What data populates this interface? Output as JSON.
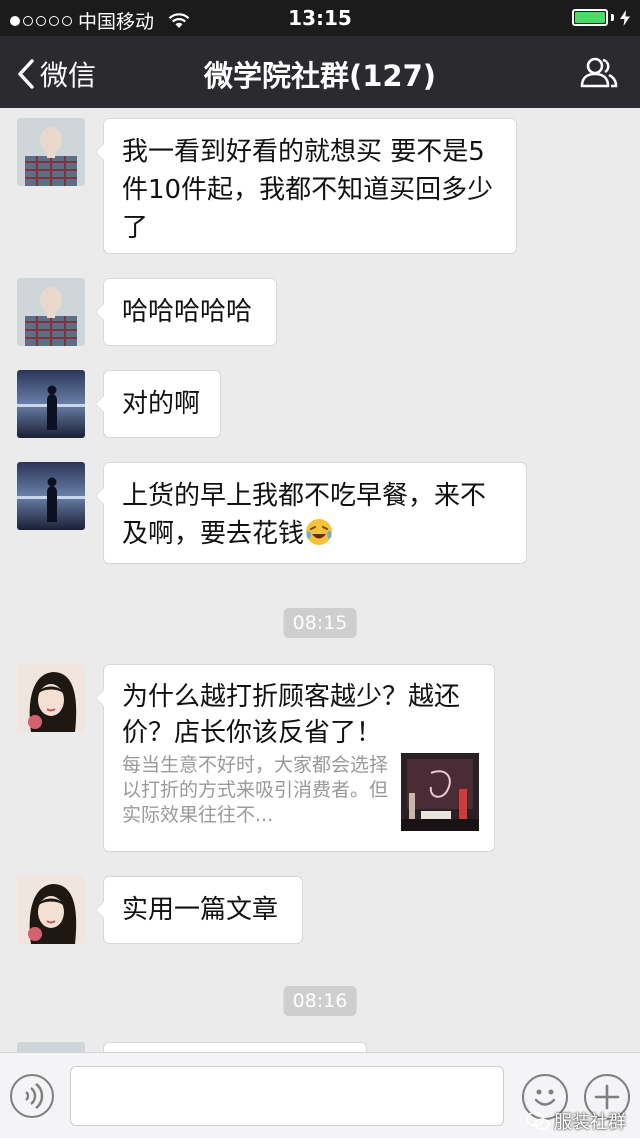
{
  "status_bar": {
    "carrier": "中国移动",
    "time": "13:15",
    "signal_dots_filled": 1,
    "signal_dots_total": 5,
    "battery_level": 1.0
  },
  "nav": {
    "back_label": "微信",
    "title": "微学院社群(127)",
    "back_icon": "chevron-left-icon",
    "members_icon": "group-members-icon"
  },
  "messages": [
    {
      "type": "text",
      "avatar": "avatar-woman-plaid",
      "text": "我一看到好看的就想买  要不是5件10件起，我都不知道买回多少了"
    },
    {
      "type": "text",
      "avatar": "avatar-woman-plaid",
      "text": "哈哈哈哈哈"
    },
    {
      "type": "text",
      "avatar": "avatar-silhouette-sea",
      "text": "对的啊"
    },
    {
      "type": "text",
      "avatar": "avatar-silhouette-sea",
      "text": "上货的早上我都不吃早餐，来不及啊，要去花钱",
      "emoji": "laughing-tears-emoji"
    },
    {
      "type": "time",
      "text": "08:15"
    },
    {
      "type": "link",
      "avatar": "avatar-woman-portrait",
      "title": "为什么越打折顾客越少？越还价？店长你该反省了！",
      "description": "每当生意不好时，大家都会选择以打折的方式来吸引消费者。但实际效果往往不..."
    },
    {
      "type": "text",
      "avatar": "avatar-woman-portrait",
      "text": "实用一篇文章"
    },
    {
      "type": "time",
      "text": "08:16"
    }
  ],
  "input_bar": {
    "voice_icon": "voice-icon",
    "emoji_icon": "emoji-icon",
    "plus_icon": "plus-icon",
    "text_value": ""
  },
  "watermark": {
    "text": "服装社群"
  },
  "colors": {
    "status_bar_bg": "#1b1b1b",
    "nav_bg": "#2b2b2f",
    "chat_bg": "#ebebeb",
    "battery_fill": "#4cd964"
  }
}
